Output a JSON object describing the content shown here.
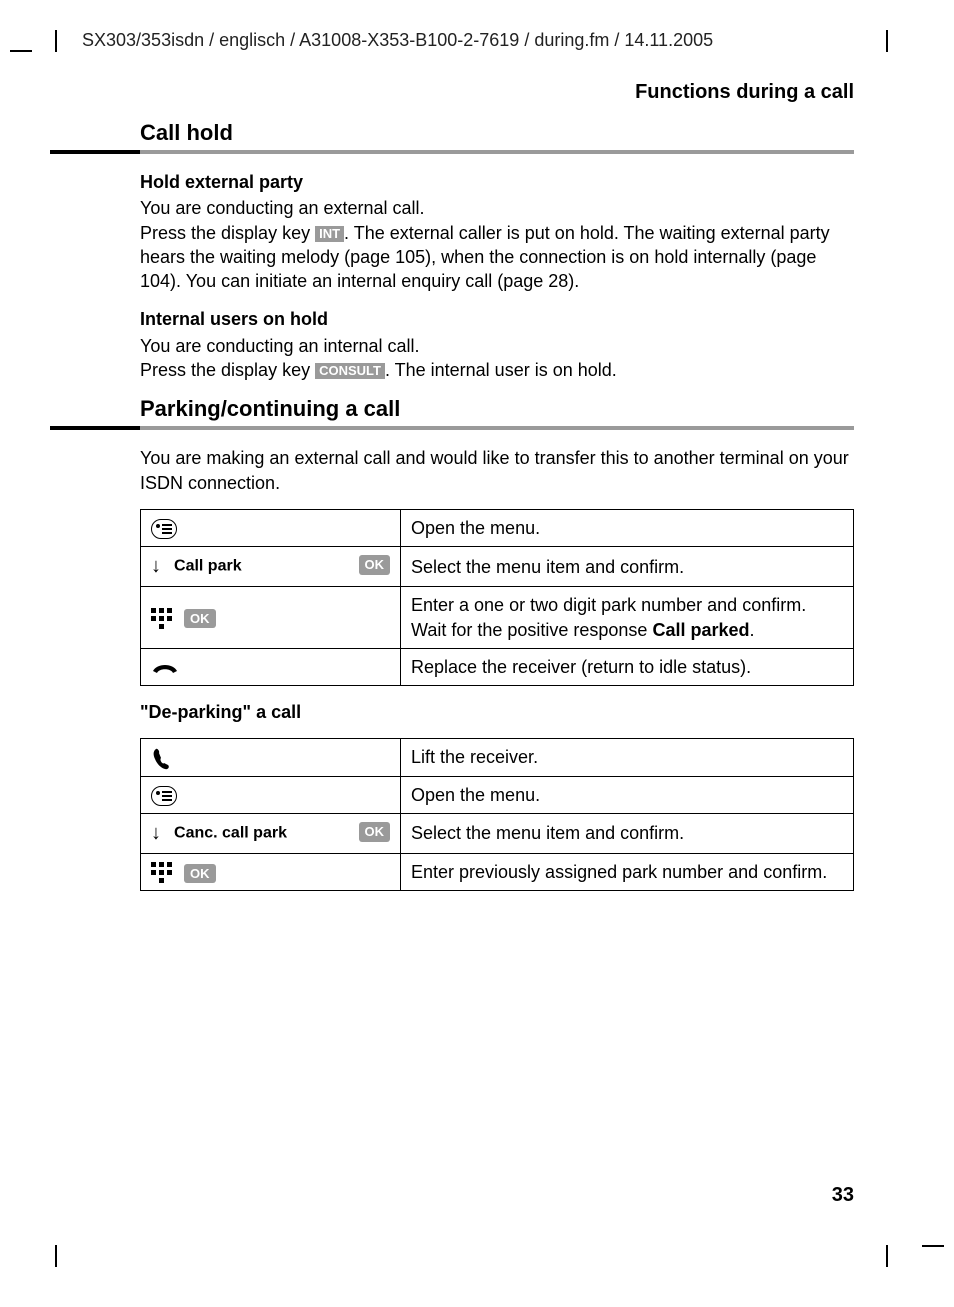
{
  "header_path": "SX303/353isdn / englisch / A31008-X353-B100-2-7619 / during.fm / 14.11.2005",
  "section_title": "Functions during a call",
  "page_number": "33",
  "sec1": {
    "heading": "Call hold",
    "sub1": "Hold external party",
    "p1a": "You are conducting an external call.",
    "p1b_pre": "Press the display key ",
    "key_int": "INT",
    "p1b_post": ". The external caller is put on hold. The waiting external party hears the waiting melody (page 105), when the connection is on hold internally (page 104). You can initiate an internal enquiry call (page 28).",
    "sub2": "Internal users on hold",
    "p2a": "You are conducting an internal call.",
    "p2b_pre": "Press the display key ",
    "key_consult": "CONSULT",
    "p2b_post": ". The internal user is on hold."
  },
  "sec2": {
    "heading": "Parking/continuing a call",
    "intro": "You are making an external call and would like to transfer this to another terminal on your ISDN connection.",
    "table1": {
      "r1": {
        "desc": "Open the menu."
      },
      "r2": {
        "label": "Call park",
        "ok": "OK",
        "desc": "Select the menu item and confirm."
      },
      "r3": {
        "ok": "OK",
        "desc_pre": "Enter a one or two digit park number and confirm. Wait for the positive response ",
        "bold": "Call parked",
        "desc_post": "."
      },
      "r4": {
        "desc": "Replace the receiver (return to idle status)."
      }
    },
    "sub_depark": "\"De-parking\" a call",
    "table2": {
      "r1": {
        "desc": "Lift the receiver."
      },
      "r2": {
        "desc": "Open the menu."
      },
      "r3": {
        "label": "Canc. call park",
        "ok": "OK",
        "desc": "Select the menu item and confirm."
      },
      "r4": {
        "ok": "OK",
        "desc": "Enter previously assigned park number and confirm."
      }
    }
  }
}
